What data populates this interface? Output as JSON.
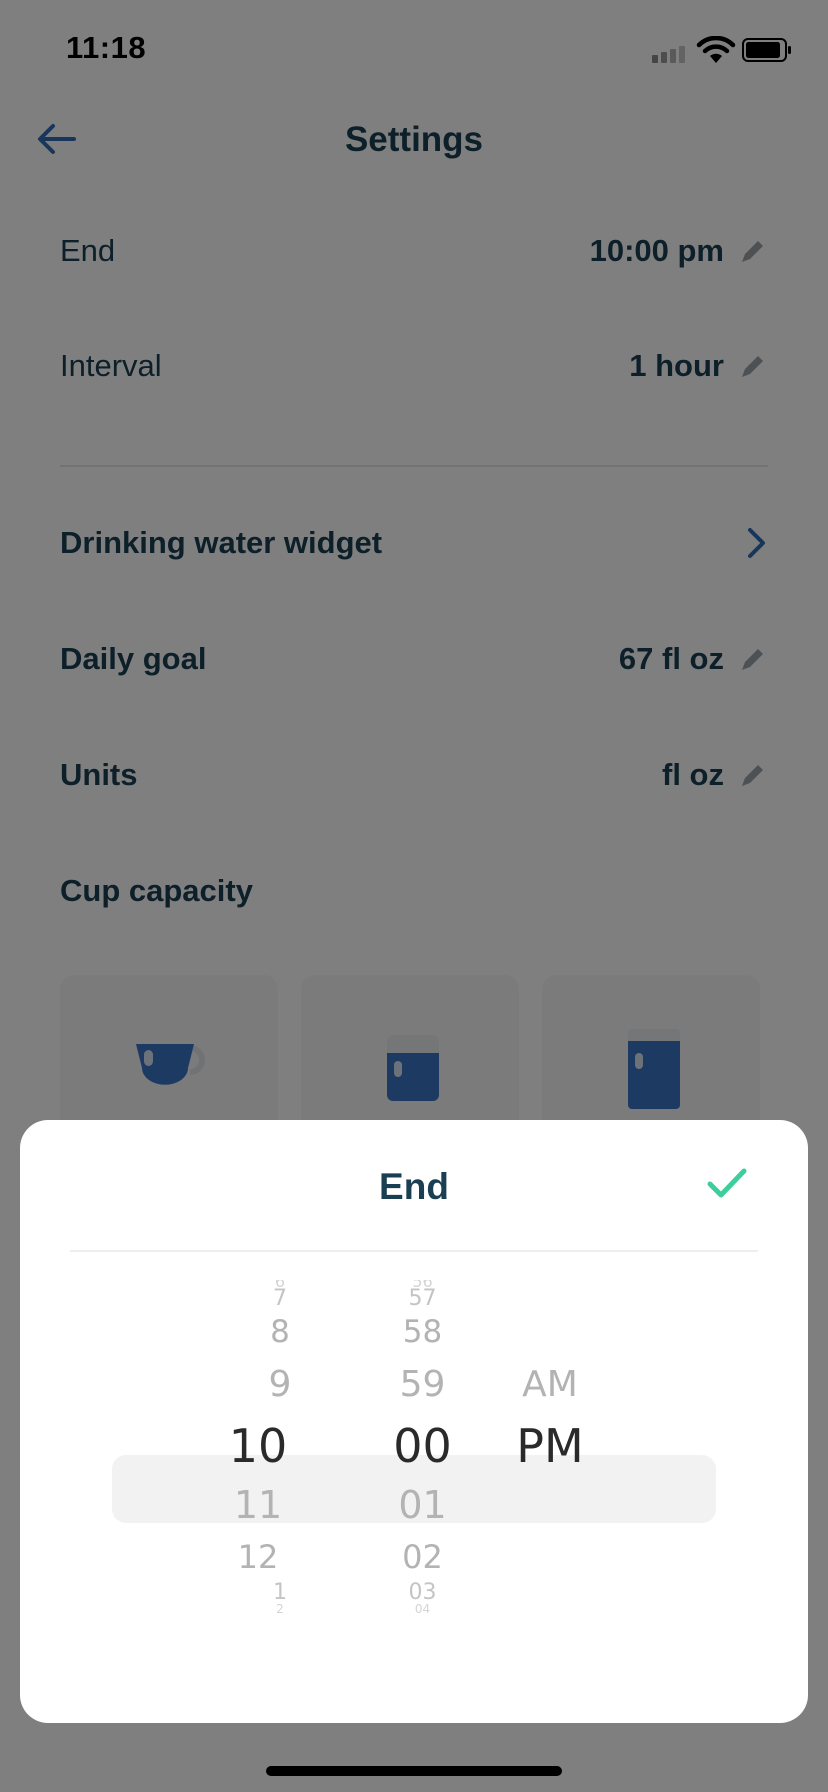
{
  "status_bar": {
    "time": "11:18"
  },
  "nav": {
    "title": "Settings"
  },
  "settings": {
    "end_label": "End",
    "end_value": "10:00 pm",
    "interval_label": "Interval",
    "interval_value": "1 hour",
    "widget_label": "Drinking water widget",
    "goal_label": "Daily goal",
    "goal_value": "67 fl oz",
    "units_label": "Units",
    "units_value": "fl oz",
    "cup_label": "Cup capacity"
  },
  "sheet": {
    "title": "End",
    "hours": [
      "6",
      "7",
      "8",
      "9",
      "10",
      "11",
      "12",
      "1",
      "2"
    ],
    "minutes": [
      "56",
      "57",
      "58",
      "59",
      "00",
      "01",
      "02",
      "03",
      "04"
    ],
    "period": [
      "AM",
      "PM"
    ],
    "selected": {
      "hour": "10",
      "minute": "00",
      "period": "PM"
    }
  },
  "colors": {
    "primary": "#1b3f52",
    "accent": "#2e6db4",
    "check": "#3ccf9c",
    "water": "#3b74c6"
  }
}
